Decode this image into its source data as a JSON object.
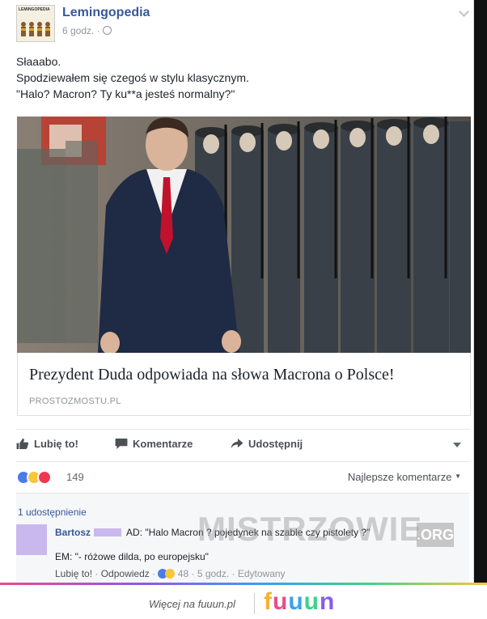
{
  "post": {
    "page_name": "Lemingopedia",
    "logo_text": "LEMINGOPEDIA",
    "time": "6 godz. ·",
    "text_lines": [
      "Słaaabo.",
      "Spodziewałem się czegoś w stylu klasycznym.",
      "\"Halo? Macron? Ty ku**a jesteś normalny?\""
    ]
  },
  "link": {
    "title": "Prezydent Duda odpowiada na słowa Macrona o Polsce!",
    "domain": "PROSTOZMOSTU.PL"
  },
  "actions": {
    "like": "Lubię to!",
    "comment": "Komentarze",
    "share": "Udostępnij"
  },
  "reactions": {
    "count": "149",
    "sort_label": "Najlepsze komentarze"
  },
  "comments": {
    "shares": "1 udostępnienie",
    "author": "Bartosz",
    "line1": "AD: \"Halo Macron ? pojedynek na szable czy pistolety ?\"",
    "line2": "EM: \"- różowe dilda, po europejsku\"",
    "like_link": "Lubię to!",
    "reply_link": "Odpowiedz",
    "reaction_count": "48",
    "time": "5 godz.",
    "edited": "Edytowany"
  },
  "watermark": {
    "main": "MISTRZOWIE",
    "org": ".ORG"
  },
  "footer": {
    "more": "Więcej na fuuun.pl",
    "brand": "fuuun",
    "brand_colors": [
      "#f2b233",
      "#e84d89",
      "#3aa0f0",
      "#3fd18a",
      "#8c5be8"
    ]
  },
  "colors": {
    "link_blue": "#365899",
    "like_blue": "#4a7ce8",
    "haha_yellow": "#f7c63a",
    "love_red": "#f0384f"
  }
}
